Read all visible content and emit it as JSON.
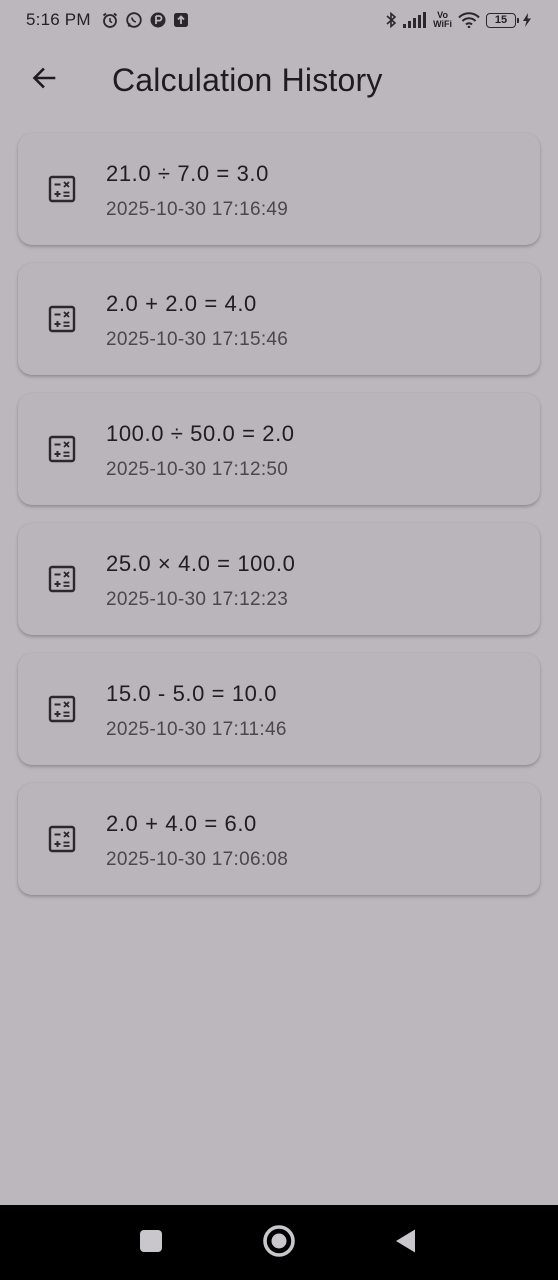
{
  "status_bar": {
    "time": "5:16 PM",
    "left_icons": [
      "alarm-icon",
      "whatsapp-icon",
      "app-notification-icon",
      "upload-icon"
    ],
    "right_icons": [
      "bluetooth-icon",
      "signal-icon",
      "vowifi-icon",
      "wifi-icon",
      "battery-icon",
      "charging-icon"
    ],
    "vowifi_top": "Vo",
    "vowifi_bottom": "WiFi",
    "battery_level": "15"
  },
  "app_bar": {
    "back_icon": "arrow-back-icon",
    "title": "Calculation History"
  },
  "history": [
    {
      "expression": "21.0 ÷ 7.0 = 3.0",
      "timestamp": "2025-10-30 17:16:49",
      "icon": "calculator-icon"
    },
    {
      "expression": "2.0 + 2.0 = 4.0",
      "timestamp": "2025-10-30 17:15:46",
      "icon": "calculator-icon"
    },
    {
      "expression": "100.0 ÷ 50.0 = 2.0",
      "timestamp": "2025-10-30 17:12:50",
      "icon": "calculator-icon"
    },
    {
      "expression": "25.0 × 4.0 = 100.0",
      "timestamp": "2025-10-30 17:12:23",
      "icon": "calculator-icon"
    },
    {
      "expression": "15.0 - 5.0 = 10.0",
      "timestamp": "2025-10-30 17:11:46",
      "icon": "calculator-icon"
    },
    {
      "expression": "2.0 + 4.0 = 6.0",
      "timestamp": "2025-10-30 17:06:08",
      "icon": "calculator-icon"
    }
  ],
  "nav_bar": {
    "buttons": [
      "recents-icon",
      "home-icon",
      "back-triangle-icon"
    ]
  },
  "colors": {
    "background": "#bbb7bc",
    "card": "#b9b5ba",
    "text_primary": "#1f1d22",
    "text_secondary": "#4a474d",
    "nav_bar": "#000000"
  }
}
